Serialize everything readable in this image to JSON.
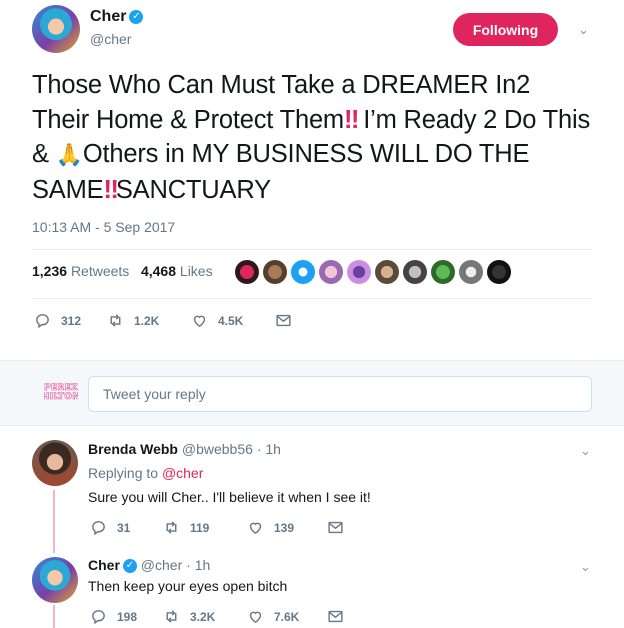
{
  "main_tweet": {
    "name": "Cher",
    "handle": "@cher",
    "follow_label": "Following",
    "text_parts": [
      "Those Who Can Must Take a DREAMER In2 Their Home & Protect Them",
      "‼",
      " I’m Ready 2 Do This & ",
      "🙏",
      "Others in MY BUSINESS WILL DO THE SAME",
      "‼",
      "SANCTUARY"
    ],
    "timestamp": "10:13 AM - 5 Sep 2017",
    "retweets_count": "1,236",
    "retweets_label": "Retweets",
    "likes_count": "4,468",
    "likes_label": "Likes",
    "replies": "312",
    "retweets": "1.2K",
    "likes": "4.5K"
  },
  "composer": {
    "placeholder": "Tweet your reply",
    "avatar_text_1": "PEREZ",
    "avatar_text_2": "HILTON"
  },
  "replies": [
    {
      "name": "Brenda Webb",
      "handle": "@bwebb56",
      "time": "· 1h",
      "replying_to_label": "Replying to",
      "replying_to": "@cher",
      "text": "Sure you will Cher.. I'll believe it when I see it!",
      "replies": "31",
      "retweets": "119",
      "likes": "139"
    },
    {
      "name": "Cher",
      "handle": "@cher",
      "time": "· 1h",
      "text": "Then keep your eyes open bitch",
      "replies": "198",
      "retweets": "3.2K",
      "likes": "7.6K"
    }
  ],
  "colors": {
    "accent": "#e0245e",
    "link_blue": "#1da1f2",
    "muted": "#657786"
  }
}
